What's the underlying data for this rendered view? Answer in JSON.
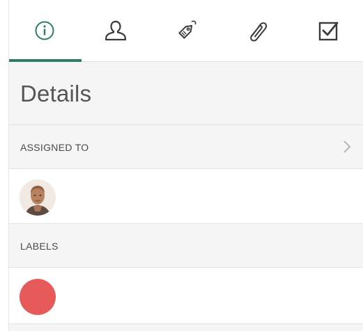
{
  "tabs": [
    {
      "name": "details",
      "icon": "info-circle-icon",
      "active": true
    },
    {
      "name": "assignee",
      "icon": "person-icon",
      "active": false
    },
    {
      "name": "labels",
      "icon": "tag-icon",
      "active": false
    },
    {
      "name": "attachments",
      "icon": "paperclip-icon",
      "active": false
    },
    {
      "name": "checklist",
      "icon": "checkbox-icon",
      "active": false
    }
  ],
  "title": "Details",
  "assigned_to": {
    "label": "ASSIGNED TO",
    "avatar": "user-avatar"
  },
  "labels": {
    "label": "LABELS",
    "items": [
      {
        "color": "#e65a5a"
      }
    ]
  },
  "colors": {
    "accent": "#2f7c66",
    "icon": "#3a3a3a",
    "label_red": "#e65a5a"
  }
}
